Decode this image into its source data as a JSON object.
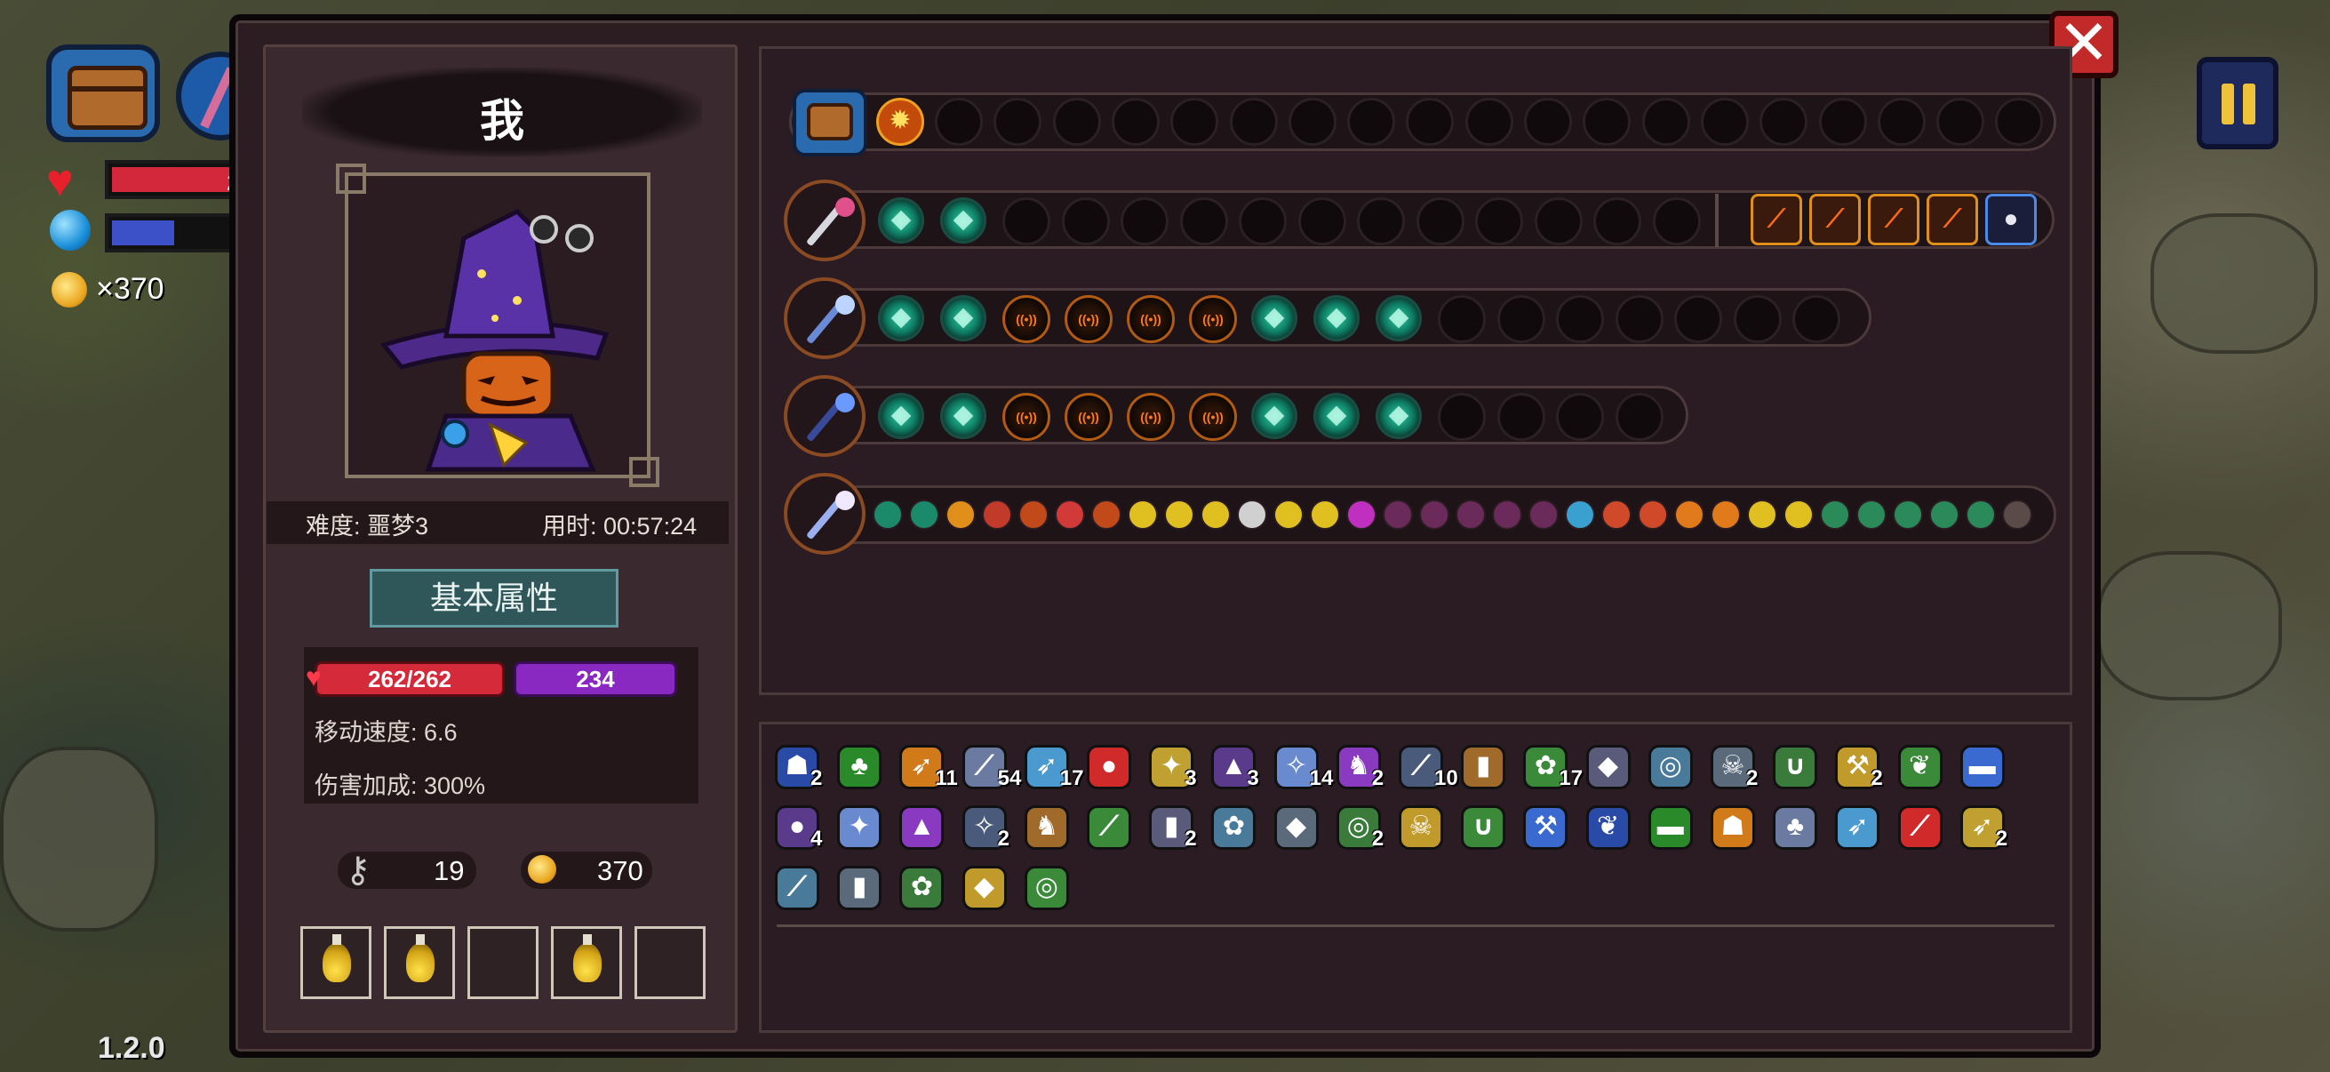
{
  "hud": {
    "hp_text": "2",
    "coin_text": "×370",
    "version": "1.2.0"
  },
  "character": {
    "name": "我",
    "difficulty": "难度: 噩梦3",
    "elapsed": "用时: 00:57:24",
    "section_title": "基本属性",
    "hp": "262/262",
    "mana": "234",
    "move_speed": "移动速度: 6.6",
    "damage_bonus": "伤害加成: 300%",
    "keys": "19",
    "coins": "370"
  },
  "close_label": "✕",
  "spell_rows": {
    "row1": {
      "filled": [
        "fire"
      ],
      "empty_count": 19
    },
    "row2": {
      "filled": [
        "rune",
        "rune"
      ],
      "empty_count": 12,
      "passives": [
        "arrow",
        "arrow",
        "arrow",
        "arrow",
        "rock"
      ]
    },
    "row3": {
      "filled": [
        "rune",
        "rune",
        "sig",
        "sig",
        "sig",
        "sig",
        "rune",
        "rune",
        "rune"
      ],
      "empty_count": 7
    },
    "row4": {
      "filled": [
        "rune",
        "rune",
        "sig",
        "sig",
        "sig",
        "sig",
        "rune",
        "rune",
        "rune"
      ],
      "empty_count": 4
    },
    "row5": {
      "spell_count": 32
    }
  },
  "inventory": {
    "rows": [
      [
        {
          "icon": "jellyfish-icon",
          "count": "2"
        },
        {
          "icon": "moss-icon",
          "count": ""
        },
        {
          "icon": "crossbow-icon",
          "count": "11"
        },
        {
          "icon": "dagger-icon",
          "count": "54"
        },
        {
          "icon": "bow-icon",
          "count": "17"
        },
        {
          "icon": "eye-icon",
          "count": ""
        },
        {
          "icon": "branch-icon",
          "count": "3"
        },
        {
          "icon": "cloak-icon",
          "count": "3"
        },
        {
          "icon": "staff-icon",
          "count": "14"
        },
        {
          "icon": "boot-icon",
          "count": "2"
        },
        {
          "icon": "spear-icon",
          "count": "10"
        },
        {
          "icon": "scroll-icon",
          "count": ""
        },
        {
          "icon": "leaf-icon",
          "count": "17"
        },
        {
          "icon": "crystal-icon",
          "count": ""
        },
        {
          "icon": "compass-icon",
          "count": ""
        },
        {
          "icon": "mask-icon",
          "count": "2"
        },
        {
          "icon": "belt-icon",
          "count": ""
        },
        {
          "icon": "hammer-icon",
          "count": "2"
        },
        {
          "icon": "sprout-icon",
          "count": ""
        },
        {
          "icon": "bullet-icon",
          "count": ""
        }
      ],
      [
        {
          "icon": "sword-icon",
          "count": "4"
        },
        {
          "icon": "claw-icon",
          "count": ""
        },
        {
          "icon": "egg-icon",
          "count": ""
        },
        {
          "icon": "horn-icon",
          "count": "2"
        },
        {
          "icon": "gear-icon",
          "count": ""
        },
        {
          "icon": "book-icon",
          "count": ""
        },
        {
          "icon": "lens-icon",
          "count": "2"
        },
        {
          "icon": "die-icon",
          "count": ""
        },
        {
          "icon": "pickaxe-icon",
          "count": ""
        },
        {
          "icon": "mallet-icon",
          "count": "2"
        },
        {
          "icon": "orb-icon",
          "count": ""
        },
        {
          "icon": "turtle-icon",
          "count": ""
        },
        {
          "icon": "pig-icon",
          "count": ""
        },
        {
          "icon": "gem-icon",
          "count": ""
        },
        {
          "icon": "demon-icon",
          "count": ""
        },
        {
          "icon": "ufo-icon",
          "count": ""
        },
        {
          "icon": "wing-icon",
          "count": ""
        },
        {
          "icon": "potion-icon",
          "count": ""
        },
        {
          "icon": "feather-icon",
          "count": ""
        },
        {
          "icon": "squid-icon",
          "count": "2"
        }
      ],
      [
        {
          "icon": "flower-icon",
          "count": ""
        },
        {
          "icon": "key-icon",
          "count": ""
        },
        {
          "icon": "wizard-hat-icon",
          "count": ""
        },
        {
          "icon": "ticket-icon",
          "count": ""
        },
        {
          "icon": "herb-icon",
          "count": ""
        }
      ]
    ]
  },
  "colors": {
    "panel_bg": "#2c1d22",
    "hp_red": "#d42a3a",
    "mana_purple": "#8a28c2",
    "accent_teal": "#2f5658",
    "close_red": "#c22a2a"
  }
}
